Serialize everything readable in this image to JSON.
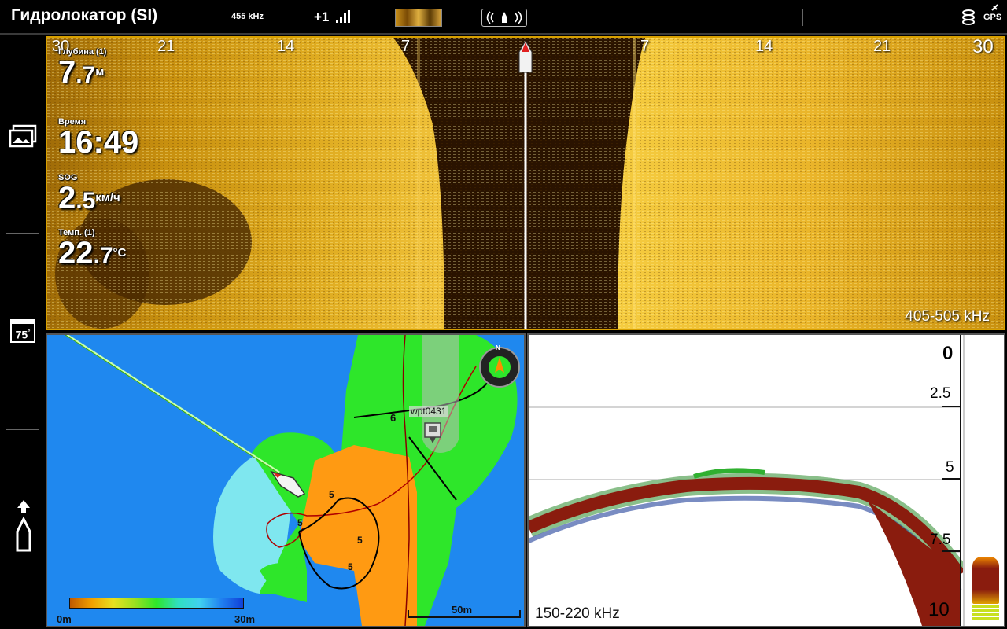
{
  "topbar": {
    "title": "Гидролокатор (SI)",
    "frequency": "455 kHz",
    "signal": "+1",
    "gps": "GPS"
  },
  "rail": {
    "temp_badge": "75"
  },
  "side_imaging": {
    "range_left": [
      "30",
      "21",
      "14",
      "7"
    ],
    "range_right": [
      "7",
      "14",
      "21",
      "30"
    ],
    "frequency": "405-505 kHz",
    "readouts": [
      {
        "label": "Глубина (1)",
        "value": "7",
        "decimal": ".7",
        "unit": "м"
      },
      {
        "label": "Время",
        "value": "16:49",
        "decimal": "",
        "unit": ""
      },
      {
        "label": "SOG",
        "value": "2",
        "decimal": ".5",
        "unit": "км/ч"
      },
      {
        "label": "Темп. (1)",
        "value": "22",
        "decimal": ".7",
        "unit": "°C"
      }
    ]
  },
  "map": {
    "waypoint": "wpt0431",
    "legend_min": "0m",
    "legend_max": "30m",
    "scale": "50m",
    "contours": [
      "6",
      "5",
      "5",
      "5",
      "5"
    ],
    "compass": "N"
  },
  "sonar": {
    "frequency": "150-220 kHz",
    "depth_ticks": [
      "0",
      "2.5",
      "5",
      "7.5",
      "10"
    ]
  }
}
